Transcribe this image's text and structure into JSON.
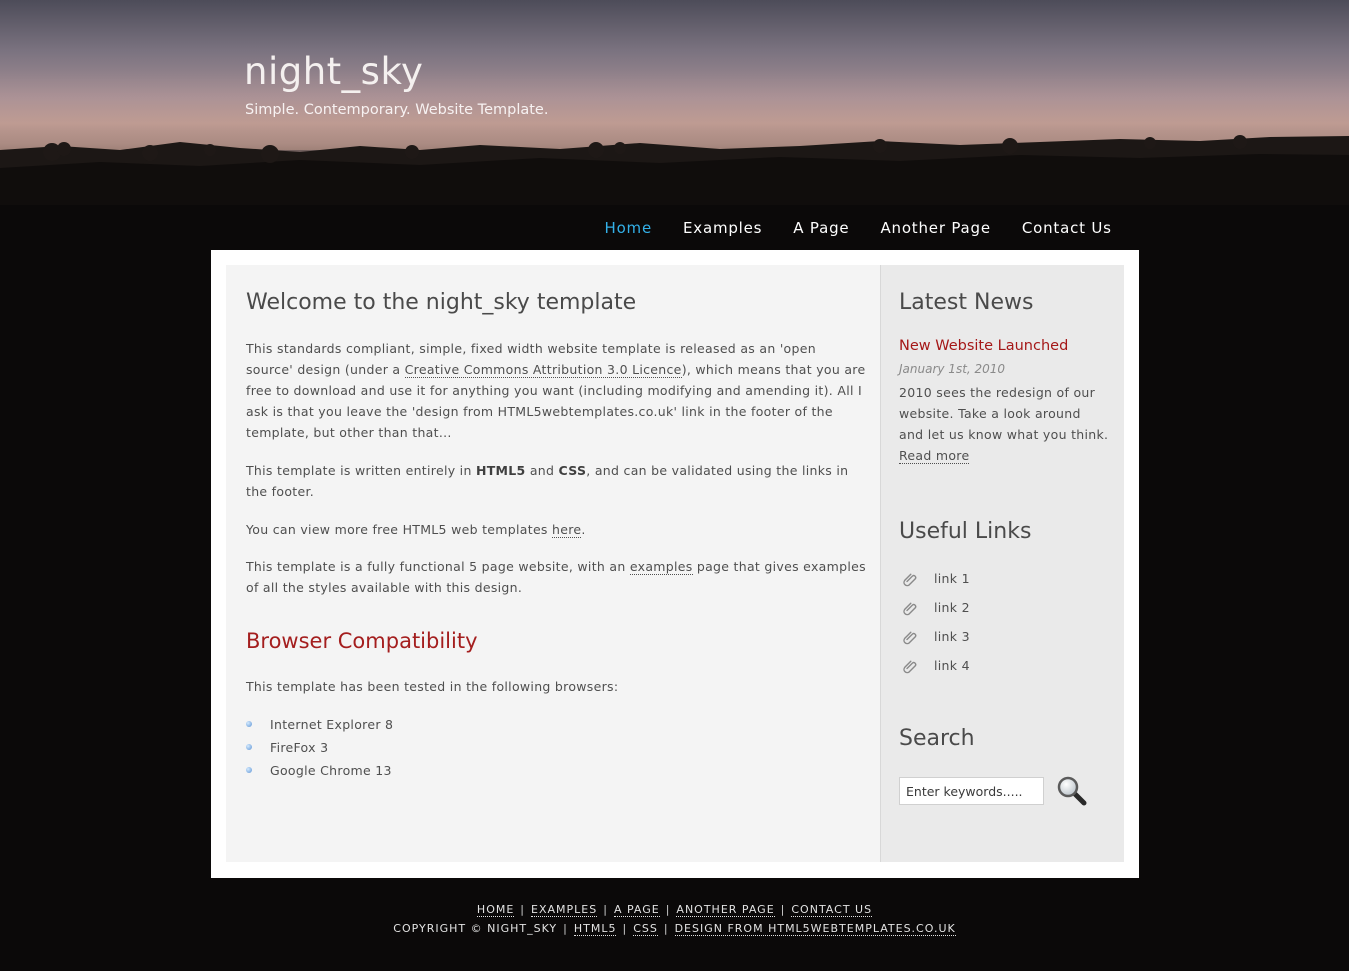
{
  "header": {
    "title": "night_sky",
    "slogan": "Simple. Contemporary. Website Template."
  },
  "menu": [
    {
      "label": "Home",
      "selected": true
    },
    {
      "label": "Examples"
    },
    {
      "label": "A Page"
    },
    {
      "label": "Another Page"
    },
    {
      "label": "Contact Us"
    }
  ],
  "colors": {
    "accent": "#33b0e8",
    "heading_red": "#a41e1e",
    "page_bg": "#0b0909"
  },
  "content": {
    "heading": "Welcome to the night_sky template",
    "intro": {
      "p1_a": "This standards compliant, simple, fixed width website template is released as an 'open source' design (under a ",
      "p1_link": "Creative Commons Attribution 3.0 Licence",
      "p1_b": "), which means that you are free to download and use it for anything you want (including modifying and amending it). All I ask is that you leave the 'design from HTML5webtemplates.co.uk' link in the footer of the template, but other than that...",
      "p2_a": "This template is written entirely in ",
      "p2_b1": "HTML5",
      "p2_mid": " and ",
      "p2_b2": "CSS",
      "p2_c": ", and can be validated using the links in the footer.",
      "p3_a": "You can view more free HTML5 web templates ",
      "p3_link": "here",
      "p3_b": ".",
      "p4_a": "This template is a fully functional 5 page website, with an ",
      "p4_link": "examples",
      "p4_b": " page that gives examples of all the styles available with this design."
    },
    "compat_heading": "Browser Compatibility",
    "compat_text": "This template has been tested in the following browsers:",
    "browsers": [
      "Internet Explorer 8",
      "FireFox 3",
      "Google Chrome 13"
    ]
  },
  "sidebar": {
    "news_heading": "Latest News",
    "news_title": "New Website Launched",
    "news_date": "January 1st, 2010",
    "news_body": "2010 sees the redesign of our website. Take a look around and let us know what you think.",
    "read_more": "Read more",
    "links_heading": "Useful Links",
    "links": [
      "link 1",
      "link 2",
      "link 3",
      "link 4"
    ],
    "link_icon": "paperclip-icon",
    "search_heading": "Search",
    "search_placeholder": "Enter keywords.....",
    "search_icon": "magnifier-icon"
  },
  "footer": {
    "nav": [
      "HOME",
      "EXAMPLES",
      "A PAGE",
      "ANOTHER PAGE",
      "CONTACT US"
    ],
    "copyright": "COPYRIGHT © NIGHT_SKY",
    "html5": "HTML5",
    "css": "CSS",
    "design": "DESIGN FROM HTML5WEBTEMPLATES.CO.UK"
  }
}
